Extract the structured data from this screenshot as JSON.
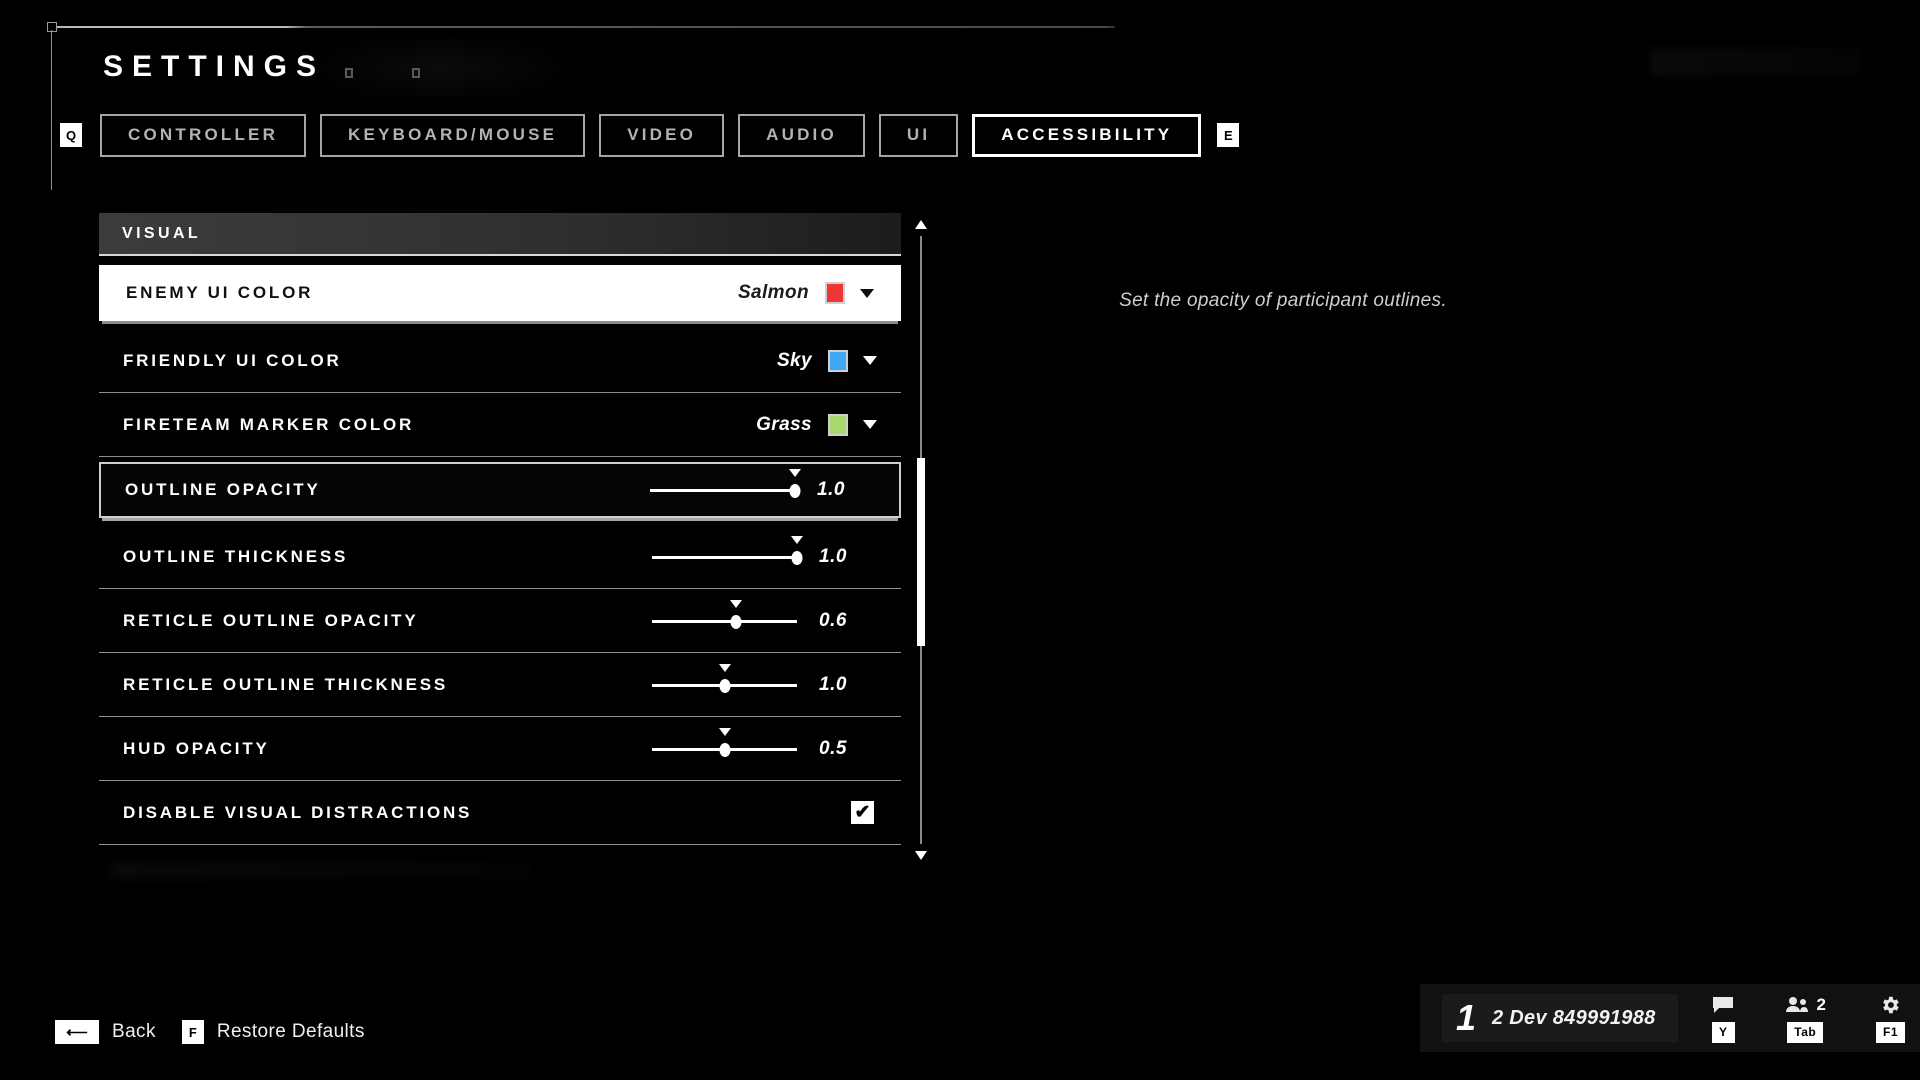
{
  "header": {
    "title": "SETTINGS",
    "left_key_hint": "Q",
    "right_key_hint": "E"
  },
  "tabs": [
    {
      "label": "CONTROLLER",
      "active": false
    },
    {
      "label": "KEYBOARD/MOUSE",
      "active": false
    },
    {
      "label": "VIDEO",
      "active": false
    },
    {
      "label": "AUDIO",
      "active": false
    },
    {
      "label": "UI",
      "active": false
    },
    {
      "label": "ACCESSIBILITY",
      "active": true
    }
  ],
  "section": {
    "title": "VISUAL"
  },
  "rows": [
    {
      "label": "ENEMY UI COLOR",
      "type": "color",
      "value": "Salmon",
      "swatch": "#f03535",
      "state": "selected"
    },
    {
      "label": "FRIENDLY UI COLOR",
      "type": "color",
      "value": "Sky",
      "swatch": "#3fa9f5",
      "state": "normal"
    },
    {
      "label": "FIRETEAM MARKER COLOR",
      "type": "color",
      "value": "Grass",
      "swatch": "#a8d86a",
      "state": "normal"
    },
    {
      "label": "OUTLINE OPACITY",
      "type": "slider",
      "value": "1.0",
      "percent": 100,
      "state": "focused"
    },
    {
      "label": "OUTLINE THICKNESS",
      "type": "slider",
      "value": "1.0",
      "percent": 100,
      "state": "normal"
    },
    {
      "label": "RETICLE OUTLINE OPACITY",
      "type": "slider",
      "value": "0.6",
      "percent": 58,
      "state": "normal"
    },
    {
      "label": "RETICLE OUTLINE THICKNESS",
      "type": "slider",
      "value": "1.0",
      "percent": 50,
      "state": "normal"
    },
    {
      "label": "HUD OPACITY",
      "type": "slider",
      "value": "0.5",
      "percent": 50,
      "state": "normal"
    },
    {
      "label": "DISABLE VISUAL DISTRACTIONS",
      "type": "checkbox",
      "checked": true,
      "check_glyph": "✔",
      "state": "normal"
    }
  ],
  "description": "Set the opacity of participant outlines.",
  "footer": {
    "back_key": "⟵",
    "back_label": "Back",
    "restore_key": "F",
    "restore_label": "Restore Defaults"
  },
  "player_card": {
    "rank": "1",
    "username": "2 Dev 849991988",
    "chat_key": "Y",
    "roster_count": "2",
    "roster_key": "Tab",
    "settings_key": "F1"
  },
  "colors": {
    "accent_white": "#ffffff",
    "panel_dark": "#111111",
    "border_grey": "#8e8e8e"
  }
}
